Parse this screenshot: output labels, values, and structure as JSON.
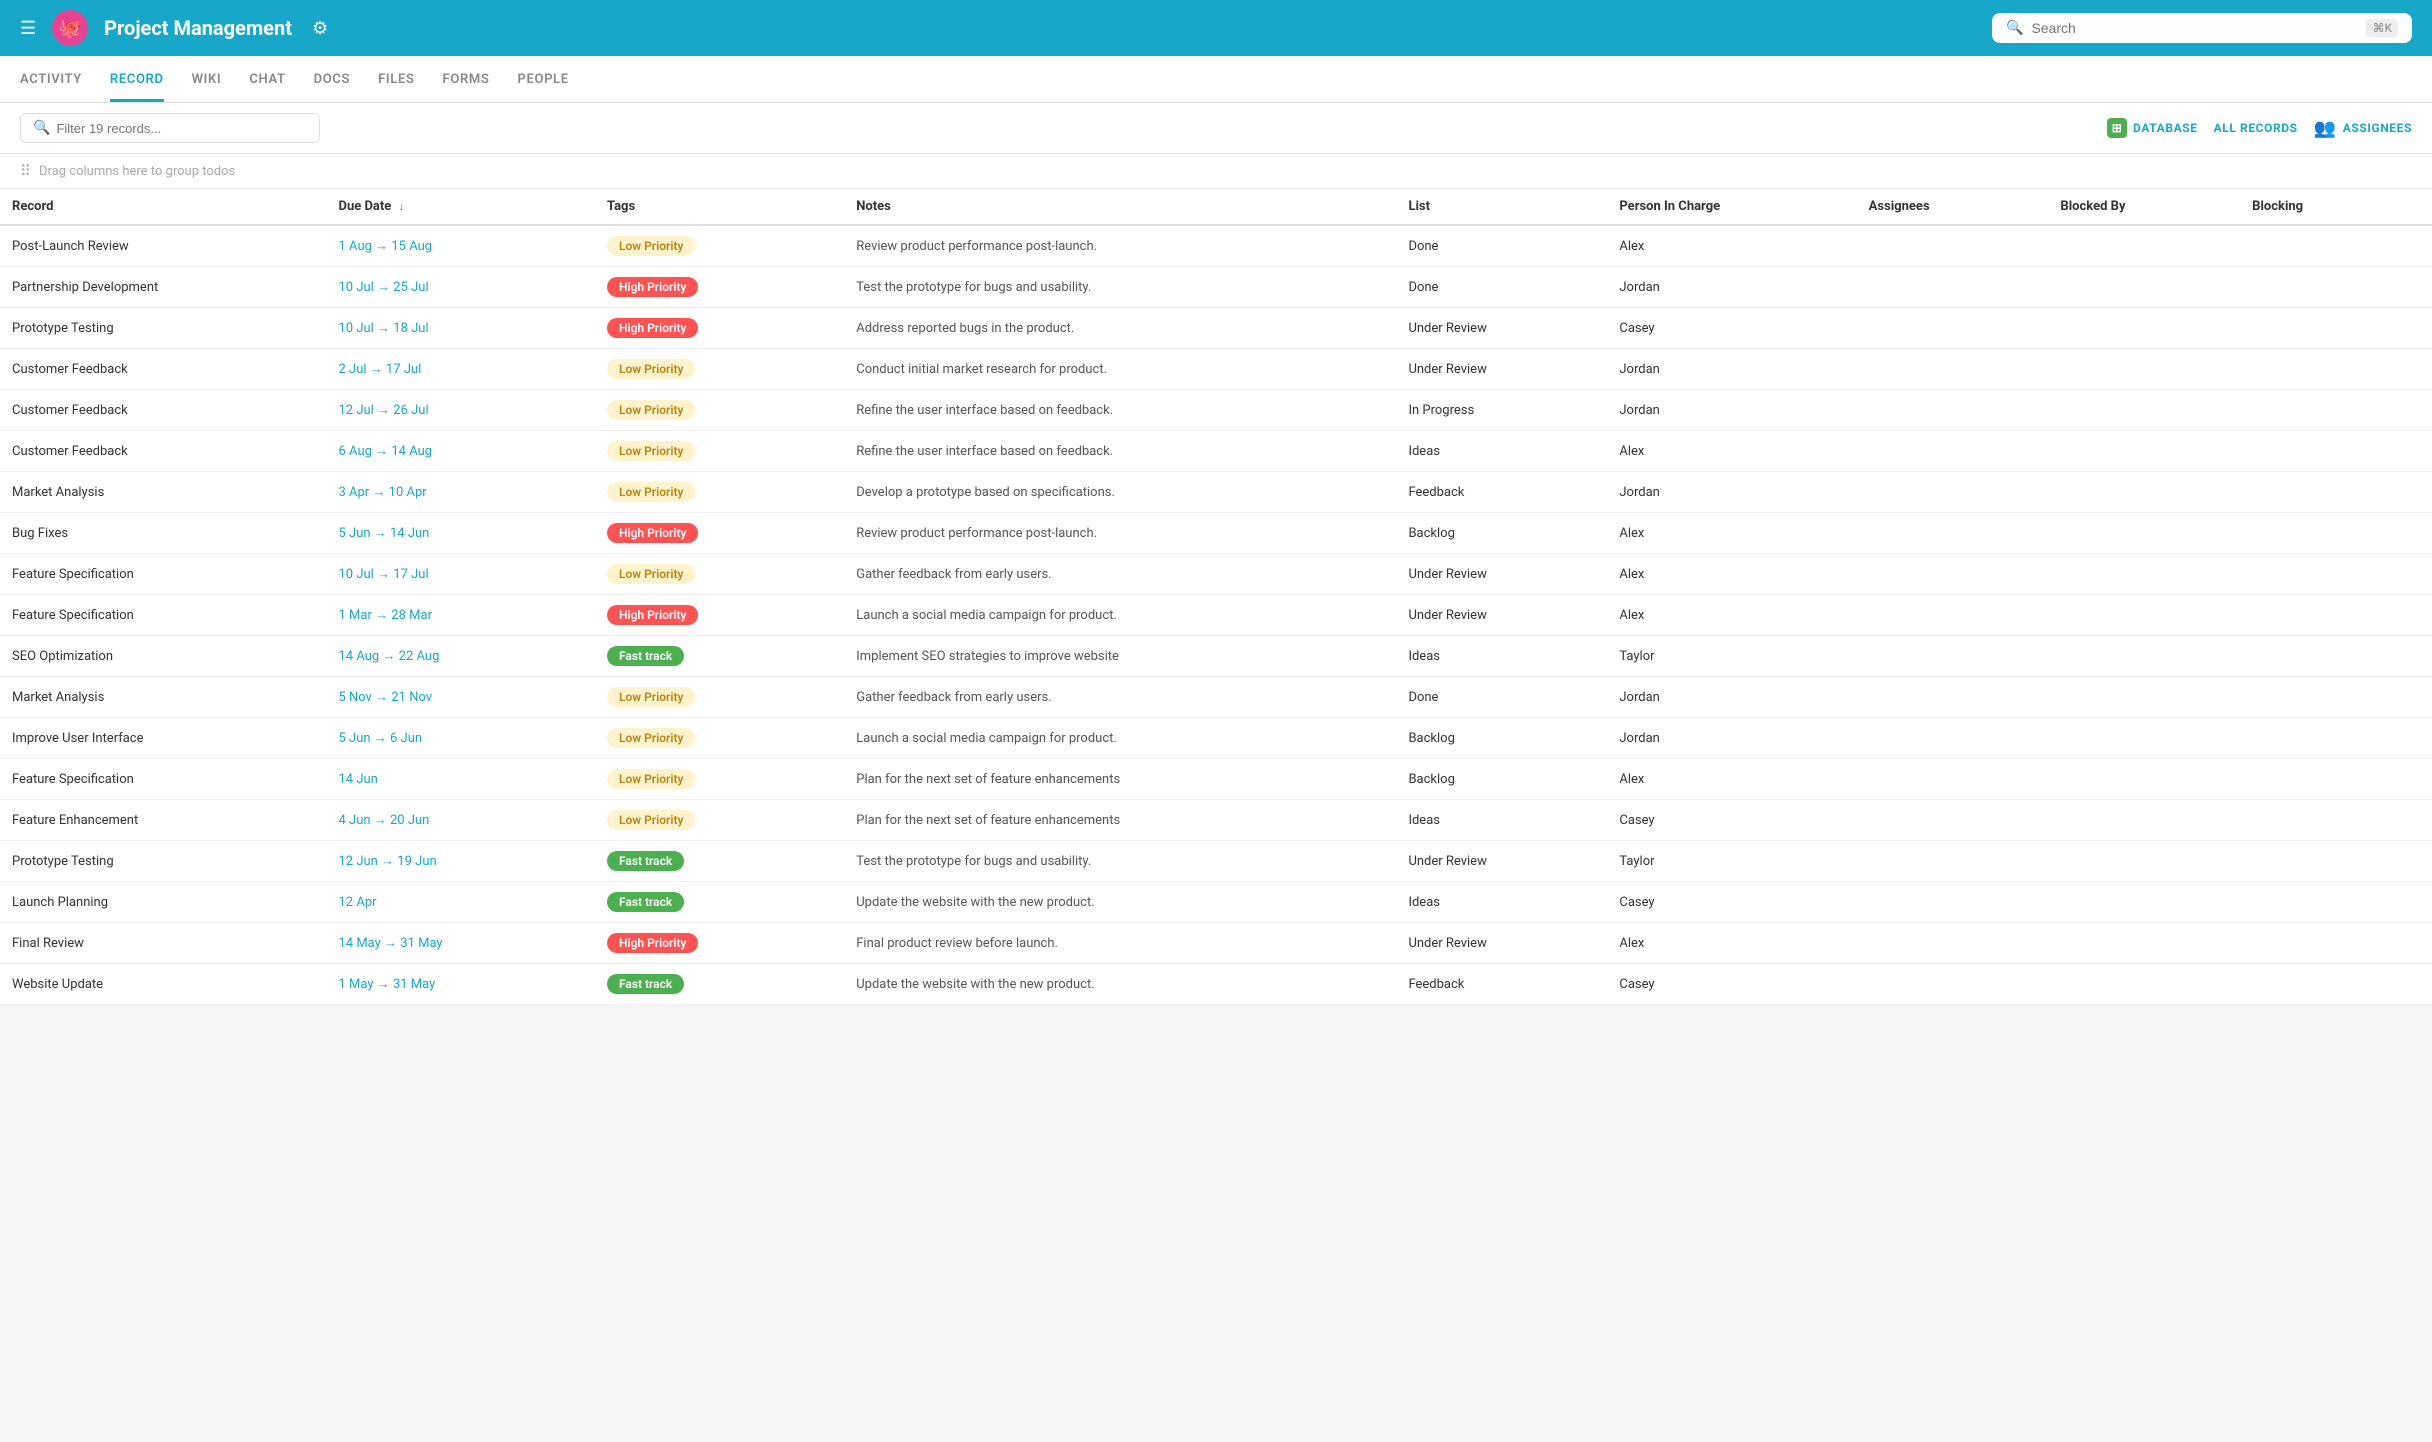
{
  "topNav": {
    "appTitle": "Project Management",
    "searchPlaceholder": "Search",
    "searchShortcut": "⌘K"
  },
  "tabs": [
    {
      "id": "activity",
      "label": "ACTIVITY",
      "active": false
    },
    {
      "id": "record",
      "label": "RECORD",
      "active": true
    },
    {
      "id": "wiki",
      "label": "WIKI",
      "active": false
    },
    {
      "id": "chat",
      "label": "CHAT",
      "active": false
    },
    {
      "id": "docs",
      "label": "DOCS",
      "active": false
    },
    {
      "id": "files",
      "label": "FILES",
      "active": false
    },
    {
      "id": "forms",
      "label": "FORMS",
      "active": false
    },
    {
      "id": "people",
      "label": "PEOPLE",
      "active": false
    }
  ],
  "toolbar": {
    "filterPlaceholder": "Filter 19 records...",
    "databaseBtn": "DATABASE",
    "allRecordsBtn": "ALL RECORDS",
    "assigneesBtn": "ASSIGNEES"
  },
  "dragHint": "Drag columns here to group todos",
  "tableHeaders": [
    {
      "id": "record",
      "label": "Record",
      "sortable": false
    },
    {
      "id": "dueDate",
      "label": "Due Date",
      "sortable": true
    },
    {
      "id": "tags",
      "label": "Tags",
      "sortable": false
    },
    {
      "id": "notes",
      "label": "Notes",
      "sortable": false
    },
    {
      "id": "list",
      "label": "List",
      "sortable": false
    },
    {
      "id": "personInCharge",
      "label": "Person In Charge",
      "sortable": false
    },
    {
      "id": "assignees",
      "label": "Assignees",
      "sortable": false
    },
    {
      "id": "blockedBy",
      "label": "Blocked By",
      "sortable": false
    },
    {
      "id": "blocking",
      "label": "Blocking",
      "sortable": false
    }
  ],
  "rows": [
    {
      "record": "Post-Launch Review",
      "dueDateDisplay": "1 Aug → 15 Aug",
      "tag": "Low Priority",
      "tagType": "low",
      "notes": "Review product performance post-launch.",
      "list": "Done",
      "person": "Alex"
    },
    {
      "record": "Partnership Development",
      "dueDateDisplay": "10 Jul → 25 Jul",
      "tag": "High Priority",
      "tagType": "high",
      "notes": "Test the prototype for bugs and usability.",
      "list": "Done",
      "person": "Jordan"
    },
    {
      "record": "Prototype Testing",
      "dueDateDisplay": "10 Jul → 18 Jul",
      "tag": "High Priority",
      "tagType": "high",
      "notes": "Address reported bugs in the product.",
      "list": "Under Review",
      "person": "Casey"
    },
    {
      "record": "Customer Feedback",
      "dueDateDisplay": "2 Jul → 17 Jul",
      "tag": "Low Priority",
      "tagType": "low",
      "notes": "Conduct initial market research for product.",
      "list": "Under Review",
      "person": "Jordan"
    },
    {
      "record": "Customer Feedback",
      "dueDateDisplay": "12 Jul → 26 Jul",
      "tag": "Low Priority",
      "tagType": "low",
      "notes": "Refine the user interface based on feedback.",
      "list": "In Progress",
      "person": "Jordan"
    },
    {
      "record": "Customer Feedback",
      "dueDateDisplay": "6 Aug → 14 Aug",
      "tag": "Low Priority",
      "tagType": "low",
      "notes": "Refine the user interface based on feedback.",
      "list": "Ideas",
      "person": "Alex"
    },
    {
      "record": "Market Analysis",
      "dueDateDisplay": "3 Apr → 10 Apr",
      "tag": "Low Priority",
      "tagType": "low",
      "notes": "Develop a prototype based on specifications.",
      "list": "Feedback",
      "person": "Jordan"
    },
    {
      "record": "Bug Fixes",
      "dueDateDisplay": "5 Jun → 14 Jun",
      "tag": "High Priority",
      "tagType": "high",
      "notes": "Review product performance post-launch.",
      "list": "Backlog",
      "person": "Alex"
    },
    {
      "record": "Feature Specification",
      "dueDateDisplay": "10 Jul → 17 Jul",
      "tag": "Low Priority",
      "tagType": "low",
      "notes": "Gather feedback from early users.",
      "list": "Under Review",
      "person": "Alex"
    },
    {
      "record": "Feature Specification",
      "dueDateDisplay": "1 Mar → 28 Mar",
      "tag": "High Priority",
      "tagType": "high",
      "notes": "Launch a social media campaign for product.",
      "list": "Under Review",
      "person": "Alex"
    },
    {
      "record": "SEO Optimization",
      "dueDateDisplay": "14 Aug → 22 Aug",
      "tag": "Fast track",
      "tagType": "fast",
      "notes": "Implement SEO strategies to improve website",
      "list": "Ideas",
      "person": "Taylor"
    },
    {
      "record": "Market Analysis",
      "dueDateDisplay": "5 Nov → 21 Nov",
      "tag": "Low Priority",
      "tagType": "low",
      "notes": "Gather feedback from early users.",
      "list": "Done",
      "person": "Jordan"
    },
    {
      "record": "Improve User Interface",
      "dueDateDisplay": "5 Jun → 6 Jun",
      "tag": "Low Priority",
      "tagType": "low",
      "notes": "Launch a social media campaign for product.",
      "list": "Backlog",
      "person": "Jordan"
    },
    {
      "record": "Feature Specification",
      "dueDateDisplay": "14 Jun",
      "tag": "Low Priority",
      "tagType": "low",
      "notes": "Plan for the next set of feature enhancements",
      "list": "Backlog",
      "person": "Alex"
    },
    {
      "record": "Feature Enhancement",
      "dueDateDisplay": "4 Jun → 20 Jun",
      "tag": "Low Priority",
      "tagType": "low",
      "notes": "Plan for the next set of feature enhancements",
      "list": "Ideas",
      "person": "Casey"
    },
    {
      "record": "Prototype Testing",
      "dueDateDisplay": "12 Jun → 19 Jun",
      "tag": "Fast track",
      "tagType": "fast",
      "notes": "Test the prototype for bugs and usability.",
      "list": "Under Review",
      "person": "Taylor"
    },
    {
      "record": "Launch Planning",
      "dueDateDisplay": "12 Apr",
      "tag": "Fast track",
      "tagType": "fast",
      "notes": "Update the website with the new product.",
      "list": "Ideas",
      "person": "Casey"
    },
    {
      "record": "Final Review",
      "dueDateDisplay": "14 May → 31 May",
      "tag": "High Priority",
      "tagType": "high",
      "notes": "Final product review before launch.",
      "list": "Under Review",
      "person": "Alex"
    },
    {
      "record": "Website Update",
      "dueDateDisplay": "1 May → 31 May",
      "tag": "Fast track",
      "tagType": "fast",
      "notes": "Update the website with the new product.",
      "list": "Feedback",
      "person": "Casey"
    }
  ]
}
